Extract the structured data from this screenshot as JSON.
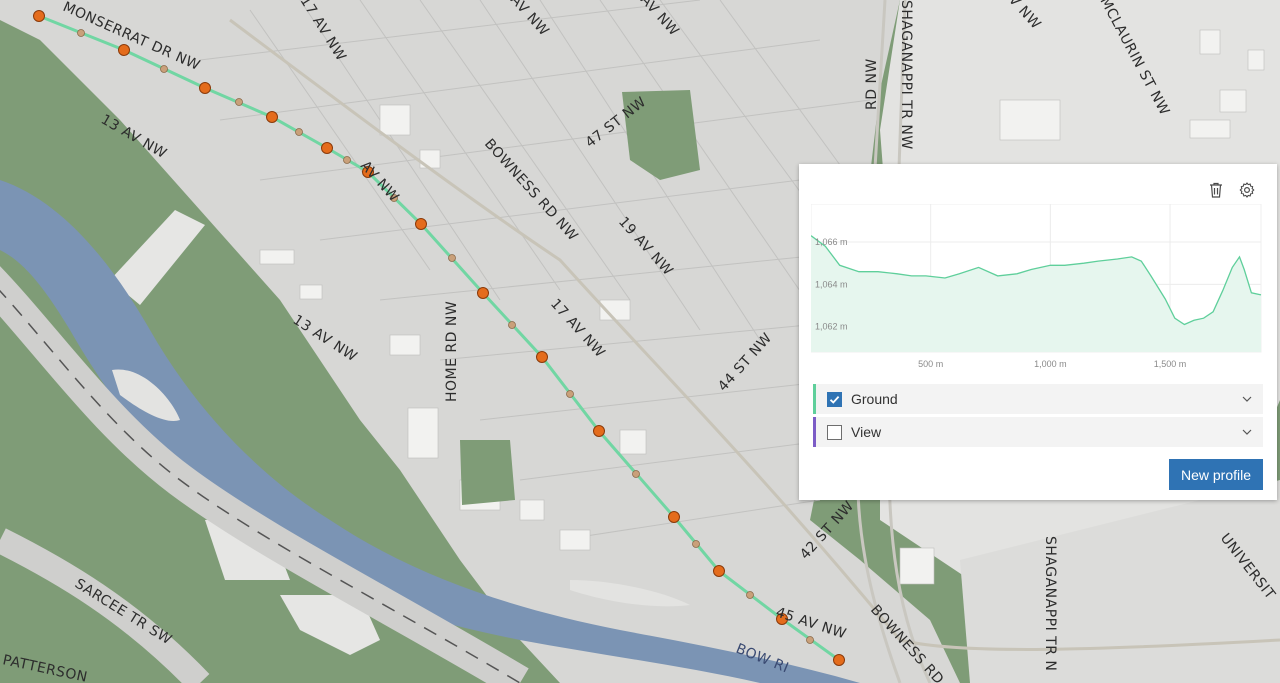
{
  "map": {
    "street_labels": [
      "MONSERRAT DR NW",
      "13 AV NW",
      "13 AV NW",
      "BOWNESS RD NW",
      "47 ST NW",
      "19 AV NW",
      "17 AV NW",
      "HOME RD NW",
      "44 ST NW",
      "42 ST NW",
      "BOWNESS RD",
      "45 AV NW",
      "BOW RI",
      "SARCEE TR SW",
      "PATTERSON",
      "SHAGANAPPI TR NW",
      "SHAGANAPPI TR N",
      "MCLAURIN ST NW",
      "UNIVERSIT",
      "17 AV NW",
      "AV NW",
      "RD NW",
      "AV NW",
      "AV NW",
      "V NW"
    ],
    "colors": {
      "grass": "#7d9a76",
      "urban": "#d4d4d2",
      "river": "#7d96b5",
      "profile_line": "#71d6a3",
      "marker": "#e46c1c"
    }
  },
  "profile": {
    "toolbar": {
      "delete_icon": "trash-icon",
      "settings_icon": "gear-icon"
    },
    "chart_data": {
      "type": "area",
      "title": "",
      "xlabel": "",
      "ylabel": "",
      "x_ticks": [
        "500 m",
        "1,000 m",
        "1,500 m"
      ],
      "y_ticks": [
        "1,066 m",
        "1,064 m",
        "1,062 m"
      ],
      "xlim": [
        0,
        1880
      ],
      "ylim": [
        1060.8,
        1067.8
      ],
      "grid": true,
      "series": [
        {
          "name": "Ground",
          "x": [
            0,
            60,
            120,
            200,
            280,
            360,
            420,
            480,
            560,
            620,
            700,
            780,
            860,
            920,
            1000,
            1060,
            1140,
            1200,
            1280,
            1340,
            1380,
            1420,
            1480,
            1520,
            1560,
            1600,
            1640,
            1680,
            1720,
            1760,
            1790,
            1810,
            1840,
            1880
          ],
          "y": [
            1066.3,
            1065.8,
            1064.9,
            1064.6,
            1064.6,
            1064.5,
            1064.4,
            1064.4,
            1064.3,
            1064.5,
            1064.8,
            1064.4,
            1064.5,
            1064.7,
            1064.9,
            1064.9,
            1065.0,
            1065.1,
            1065.2,
            1065.3,
            1065.1,
            1064.4,
            1063.3,
            1062.4,
            1062.1,
            1062.3,
            1062.4,
            1062.7,
            1063.7,
            1064.8,
            1065.3,
            1064.7,
            1063.6,
            1063.5
          ]
        }
      ]
    },
    "lines": [
      {
        "label": "Ground",
        "checked": true,
        "color": "#5fcf9b"
      },
      {
        "label": "View",
        "checked": false,
        "color": "#7c5cc6"
      }
    ],
    "new_profile_label": "New profile"
  }
}
